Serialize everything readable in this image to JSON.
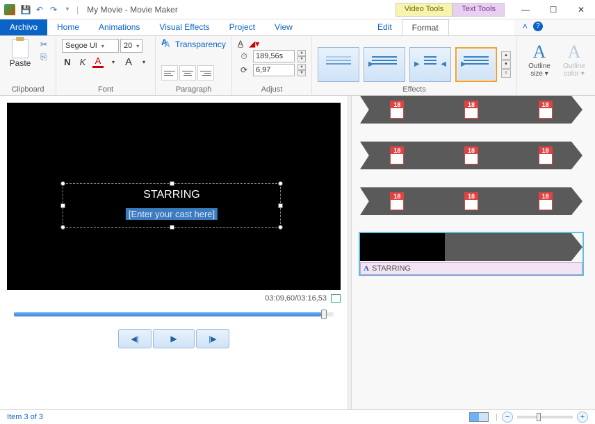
{
  "titlebar": {
    "doc_title": "My Movie - Movie Maker"
  },
  "tool_tabs": {
    "video": "Video Tools",
    "video_sub": "Edit",
    "text": "Text Tools",
    "text_sub": "Format"
  },
  "tabs": {
    "file": "Archivo",
    "home": "Home",
    "anim": "Animations",
    "vfx": "Visual Effects",
    "project": "Project",
    "view": "View"
  },
  "ribbon": {
    "clipboard": {
      "paste": "Paste",
      "label": "Clipboard"
    },
    "font": {
      "face": "Segoe UI",
      "size": "20",
      "bold": "N",
      "italic": "K",
      "colorA": "A",
      "sizeA": "A",
      "label": "Font",
      "transparency": "Transparency"
    },
    "paragraph": {
      "label": "Paragraph"
    },
    "adjust": {
      "start": "189,56s",
      "duration": "6,97",
      "label": "Adjust"
    },
    "effects": {
      "label": "Effects"
    },
    "outline": {
      "size": "Outline size",
      "color": "Outline color"
    }
  },
  "preview": {
    "title": "STARRING",
    "placeholder": "[Enter your cast here]",
    "timecode": "03:09,60/03:16,53"
  },
  "timeline": {
    "badge_num": "18",
    "caption_text": "STARRING"
  },
  "status": {
    "item": "Item 3 of 3",
    "minus": "−",
    "plus": "+"
  }
}
